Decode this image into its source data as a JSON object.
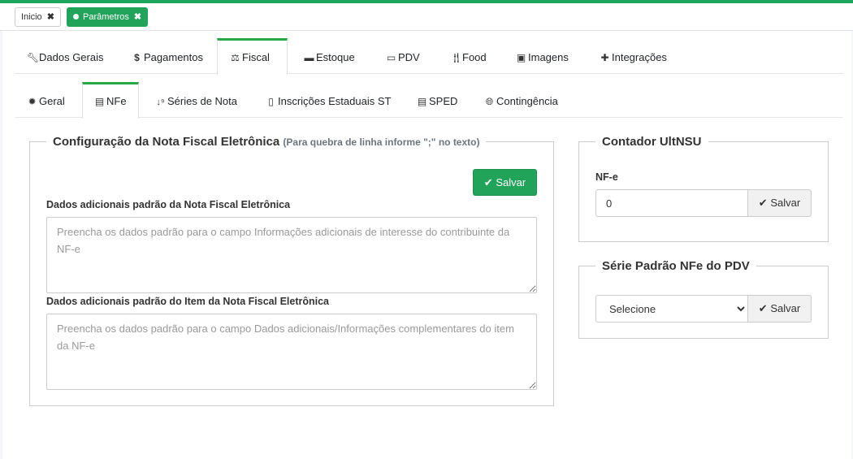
{
  "page_tabs": [
    {
      "label": "Inicio",
      "active": false
    },
    {
      "label": "Parâmetros",
      "active": true
    }
  ],
  "main_tabs": [
    {
      "label": "Dados Gerais",
      "icon": "wrench-icon"
    },
    {
      "label": "Pagamentos",
      "icon": "dollar-icon"
    },
    {
      "label": "Fiscal",
      "icon": "balance-scale-icon",
      "active": true
    },
    {
      "label": "Estoque",
      "icon": "archive-icon"
    },
    {
      "label": "PDV",
      "icon": "desktop-icon"
    },
    {
      "label": "Food",
      "icon": "cutlery-icon"
    },
    {
      "label": "Imagens",
      "icon": "image-icon"
    },
    {
      "label": "Integrações",
      "icon": "puzzle-icon"
    }
  ],
  "sub_tabs": [
    {
      "label": "Geral",
      "icon": "cog-icon"
    },
    {
      "label": "NFe",
      "icon": "file-text-icon",
      "active": true
    },
    {
      "label": "Séries de Nota",
      "icon": "sort-numeric-icon"
    },
    {
      "label": "Inscrições Estaduais ST",
      "icon": "file-text-o-icon"
    },
    {
      "label": "SPED",
      "icon": "file-text-icon"
    },
    {
      "label": "Contingência",
      "icon": "globe-icon"
    }
  ],
  "nfe_config": {
    "title": "Configuração da Nota Fiscal Eletrônica",
    "hint": "(Para quebra de linha informe \";\" no texto)",
    "save_label": "Salvar",
    "field1_label": "Dados adicionais padrão da Nota Fiscal Eletrônica",
    "field1_placeholder": "Preencha os dados padrão para o campo Informações adicionais de interesse do contribuinte da NF-e",
    "field2_label": "Dados adicionais padrão do Item da Nota Fiscal Eletrônica",
    "field2_placeholder": "Preencha os dados padrão para o campo Dados adicionais/Informações complementares do item da NF-e"
  },
  "contador": {
    "title": "Contador UltNSU",
    "field_label": "NF-e",
    "value": "0",
    "save_label": "Salvar"
  },
  "serie_pdv": {
    "title": "Série Padrão NFe do PDV",
    "selected": "Selecione",
    "save_label": "Salvar"
  },
  "colors": {
    "accent": "#22a35a",
    "top_line": "#1fa55b"
  }
}
